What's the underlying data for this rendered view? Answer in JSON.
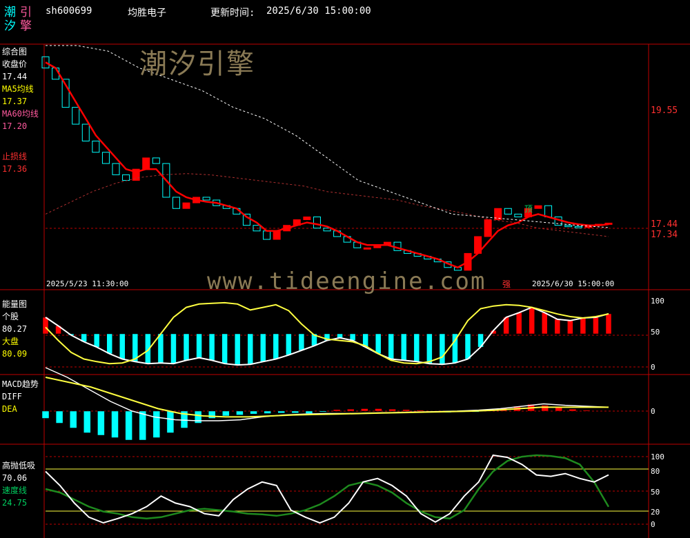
{
  "header": {
    "logo_chars": [
      "潮",
      "引",
      "汐",
      "擎"
    ],
    "code": "sh600699",
    "name": "均胜电子",
    "update_label": "更新时间:",
    "update_time": "2025/6/30 15:00:00"
  },
  "watermarks": {
    "brand": "潮汐引擎",
    "url": "www.tideengine.com"
  },
  "panel_main": {
    "title": "综合图",
    "close_label": "收盘价",
    "close_value": "17.44",
    "ma5_label": "MA5均线",
    "ma5_value": "17.37",
    "ma60_label": "MA60均线",
    "ma60_value": "17.20",
    "stop_label": "止损线",
    "stop_value": "17.36",
    "price_labels": [
      "19.55",
      "17.44",
      "17.34"
    ],
    "date_start": "2025/5/23 11:30:00",
    "date_end": "2025/6/30 15:00:00",
    "mark_top": "顶",
    "mark_strong": "强"
  },
  "panel_energy": {
    "title": "能量图",
    "stock_label": "个股",
    "stock_value": "80.27",
    "market_label": "大盘",
    "market_value": "80.09",
    "scale": [
      "100",
      "50",
      "0"
    ]
  },
  "panel_macd": {
    "title": "MACD趋势",
    "diff_label": "DIFF",
    "dea_label": "DEA",
    "scale": [
      "0"
    ]
  },
  "panel_osc": {
    "title": "高抛低吸",
    "value1": "70.06",
    "speed_label": "速度线",
    "speed_value": "24.75",
    "scale": [
      "100",
      "80",
      "50",
      "20",
      "0"
    ]
  },
  "colors": {
    "grid_red": "#c00000",
    "up": "#ff0000",
    "down": "#00ffff",
    "ma5": "#ff0000",
    "ma60": "#b03030",
    "energy_stock": "#ffffff",
    "energy_market": "#ffff40",
    "osc_white": "#ffffff",
    "osc_green": "#1e8a1e"
  },
  "chart_data": [
    {
      "type": "candlestick",
      "title": "综合图",
      "x_range": [
        "2025/5/23 11:30:00",
        "2025/6/30 15:00:00"
      ],
      "ylim": [
        16.5,
        20.6
      ],
      "annotations": [
        "顶",
        "强"
      ],
      "close": [
        20.2,
        20.0,
        19.5,
        19.2,
        18.9,
        18.7,
        18.5,
        18.3,
        18.2,
        18.4,
        18.6,
        18.5,
        17.9,
        17.7,
        17.8,
        17.9,
        17.85,
        17.75,
        17.7,
        17.6,
        17.4,
        17.3,
        17.15,
        17.3,
        17.4,
        17.5,
        17.55,
        17.35,
        17.3,
        17.2,
        17.1,
        17.0,
        17.0,
        17.05,
        17.1,
        16.95,
        16.9,
        16.85,
        16.8,
        16.75,
        16.65,
        16.6,
        16.9,
        17.2,
        17.5,
        17.7,
        17.6,
        17.55,
        17.7,
        17.75,
        17.55,
        17.4,
        17.38,
        17.36,
        17.4,
        17.42,
        17.44
      ],
      "series": [
        {
          "name": "MA5均线",
          "values": [
            20.3,
            20.2,
            19.9,
            19.6,
            19.3,
            19.0,
            18.8,
            18.6,
            18.4,
            18.35,
            18.4,
            18.4,
            18.2,
            18.0,
            17.9,
            17.85,
            17.82,
            17.8,
            17.75,
            17.7,
            17.55,
            17.45,
            17.3,
            17.3,
            17.35,
            17.4,
            17.45,
            17.42,
            17.38,
            17.3,
            17.2,
            17.1,
            17.05,
            17.05,
            17.05,
            17.0,
            16.95,
            16.9,
            16.85,
            16.8,
            16.72,
            16.65,
            16.75,
            16.9,
            17.1,
            17.3,
            17.4,
            17.45,
            17.55,
            17.6,
            17.55,
            17.5,
            17.45,
            17.42,
            17.4,
            17.4,
            17.42
          ]
        },
        {
          "name": "MA60均线",
          "values": [
            17.6,
            17.8,
            18.0,
            18.15,
            18.25,
            18.3,
            18.32,
            18.3,
            18.25,
            18.2,
            18.15,
            18.1,
            18.0,
            17.95,
            17.9,
            17.85,
            17.75,
            17.68,
            17.6,
            17.5,
            17.45,
            17.35,
            17.3,
            17.25,
            17.2
          ]
        },
        {
          "name": "止损线",
          "values": [
            20.6,
            20.6,
            20.5,
            20.2,
            20.0,
            19.8,
            19.5,
            19.3,
            19.0,
            18.6,
            18.2,
            18.0,
            17.8,
            17.6,
            17.55,
            17.5,
            17.45,
            17.4,
            17.36
          ]
        }
      ]
    },
    {
      "type": "line",
      "title": "能量图",
      "ylim": [
        0,
        100
      ],
      "series": [
        {
          "name": "个股",
          "values": [
            75,
            62,
            48,
            38,
            30,
            20,
            12,
            8,
            5,
            6,
            5,
            10,
            14,
            10,
            5,
            3,
            4,
            8,
            12,
            18,
            25,
            32,
            40,
            44,
            40,
            30,
            20,
            12,
            10,
            8,
            5,
            4,
            6,
            12,
            30,
            55,
            75,
            82,
            90,
            82,
            72,
            70,
            74,
            75,
            80.27
          ]
        },
        {
          "name": "大盘",
          "values": [
            60,
            40,
            22,
            12,
            8,
            5,
            6,
            12,
            25,
            50,
            75,
            90,
            95,
            96,
            97,
            95,
            86,
            90,
            94,
            85,
            65,
            48,
            42,
            40,
            38,
            32,
            20,
            10,
            6,
            5,
            8,
            15,
            40,
            70,
            88,
            92,
            94,
            93,
            90,
            85,
            80,
            76,
            74,
            76,
            80.09
          ]
        }
      ]
    },
    {
      "type": "bar",
      "title": "MACD趋势",
      "series": [
        {
          "name": "MACD",
          "values": [
            -0.15,
            -0.25,
            -0.35,
            -0.45,
            -0.5,
            -0.55,
            -0.6,
            -0.6,
            -0.55,
            -0.45,
            -0.35,
            -0.25,
            -0.15,
            -0.1,
            -0.08,
            -0.06,
            -0.05,
            -0.04,
            -0.04,
            -0.05,
            -0.02,
            0.03,
            0.04,
            0.05,
            0.05,
            0.04,
            0.03,
            0.02,
            -0.02,
            -0.03,
            -0.02,
            -0.02,
            0.02,
            0.06,
            0.1,
            0.14,
            0.12,
            0.08,
            0.04,
            0.02
          ]
        },
        {
          "name": "DIFF",
          "values": [
            0.9,
            0.7,
            0.45,
            0.2,
            0.0,
            -0.12,
            -0.18,
            -0.2,
            -0.2,
            -0.18,
            -0.12,
            -0.08,
            -0.06,
            -0.05,
            -0.05,
            -0.04,
            -0.03,
            -0.02,
            -0.01,
            0.0,
            0.02,
            0.05,
            0.1,
            0.15,
            0.12,
            0.1,
            0.08
          ]
        },
        {
          "name": "DEA",
          "values": [
            0.7,
            0.6,
            0.5,
            0.35,
            0.2,
            0.05,
            -0.05,
            -0.1,
            -0.12,
            -0.12,
            -0.1,
            -0.08,
            -0.07,
            -0.06,
            -0.05,
            -0.04,
            -0.03,
            -0.02,
            -0.01,
            0.0,
            0.02,
            0.05,
            0.08,
            0.08,
            0.08,
            0.08
          ]
        }
      ]
    },
    {
      "type": "line",
      "title": "高抛低吸",
      "ylim": [
        0,
        100
      ],
      "series": [
        {
          "name": "高抛低吸",
          "values": [
            75,
            55,
            30,
            10,
            2,
            8,
            15,
            25,
            40,
            30,
            25,
            15,
            12,
            35,
            50,
            60,
            55,
            20,
            10,
            2,
            10,
            30,
            60,
            65,
            55,
            40,
            15,
            3,
            15,
            40,
            60,
            98,
            95,
            85,
            70,
            68,
            72,
            65,
            60,
            70.06
          ]
        },
        {
          "name": "速度线",
          "values": [
            50,
            45,
            35,
            25,
            18,
            15,
            10,
            8,
            10,
            15,
            20,
            22,
            20,
            18,
            15,
            14,
            12,
            15,
            20,
            28,
            40,
            55,
            60,
            55,
            45,
            30,
            18,
            10,
            8,
            20,
            50,
            75,
            90,
            96,
            98,
            97,
            94,
            85,
            60,
            24.75
          ]
        }
      ]
    }
  ]
}
